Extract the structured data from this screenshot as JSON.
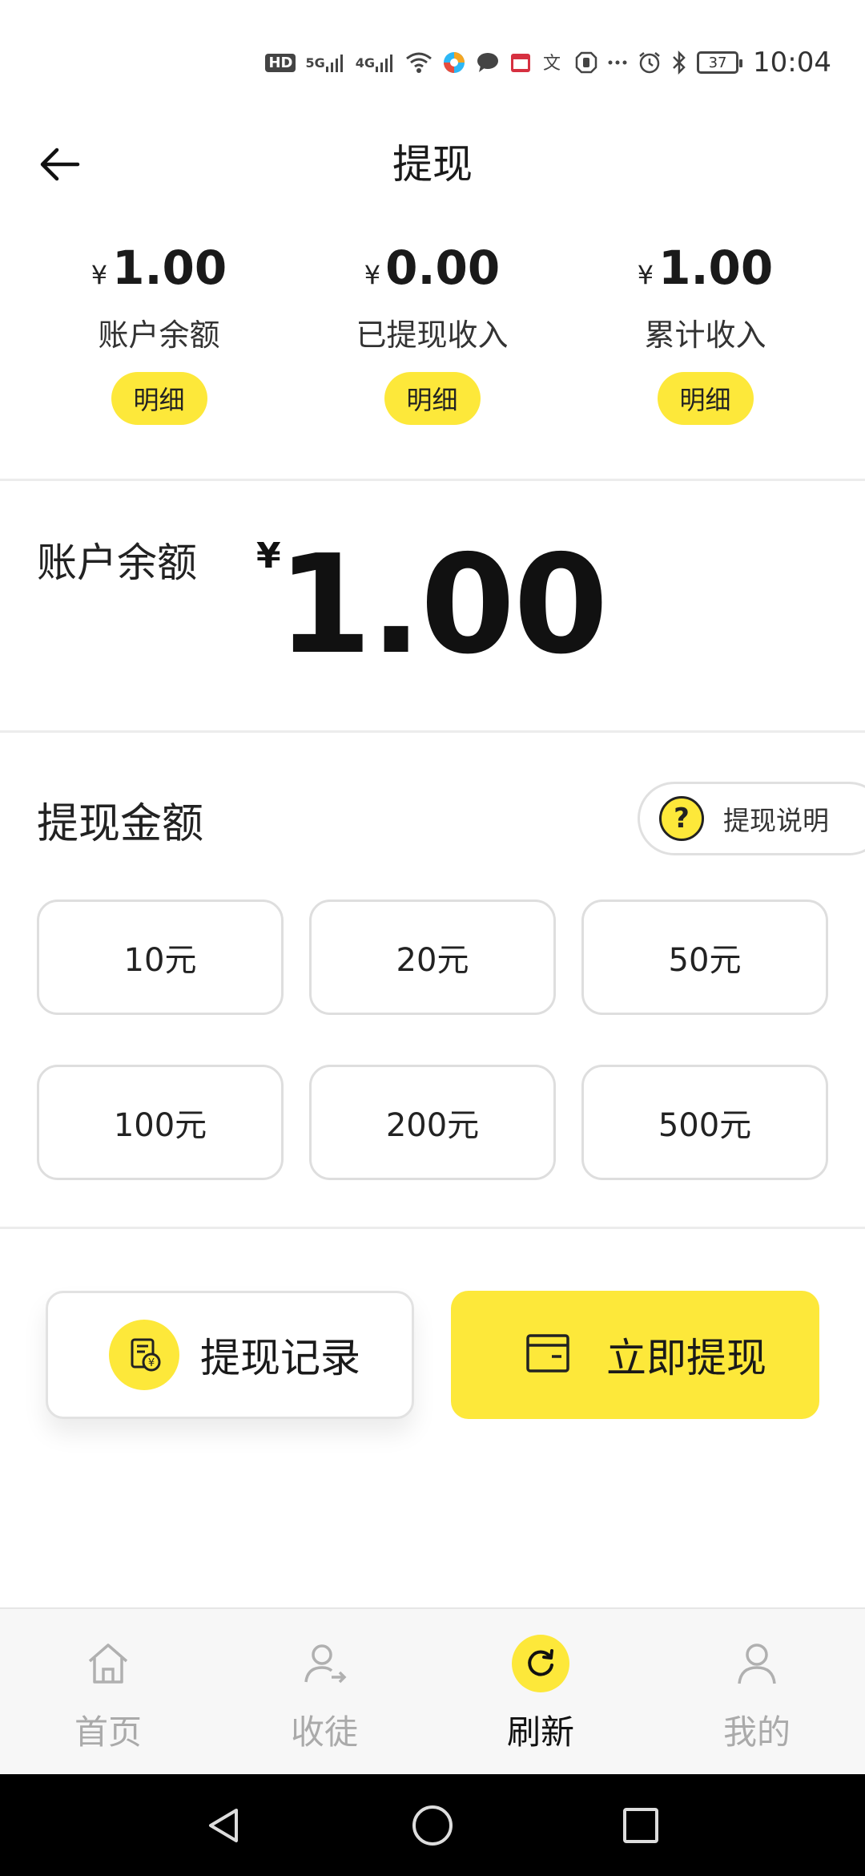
{
  "status_bar": {
    "hd": "HD",
    "sig1": "5G",
    "sig2": "4G",
    "battery": "37",
    "time": "10:04",
    "icons": [
      "hd-icon",
      "signal-5g-icon",
      "signal-4g-icon",
      "wifi-icon",
      "app-icon",
      "message-icon",
      "calendar-icon",
      "translate-icon",
      "hand-icon",
      "more-icon",
      "alarm-icon",
      "bluetooth-icon",
      "battery-icon"
    ]
  },
  "header": {
    "title": "提现",
    "back_icon": "arrow-left-icon"
  },
  "stats": [
    {
      "currency": "¥",
      "value": "1.00",
      "label": "账户余额",
      "button": "明细"
    },
    {
      "currency": "¥",
      "value": "0.00",
      "label": "已提现收入",
      "button": "明细"
    },
    {
      "currency": "¥",
      "value": "1.00",
      "label": "累计收入",
      "button": "明细"
    }
  ],
  "balance": {
    "label": "账户余额",
    "currency": "¥",
    "value": "1.00"
  },
  "withdraw": {
    "title": "提现金额",
    "explain_label": "提现说明",
    "explain_icon_text": "?",
    "options": [
      "10元",
      "20元",
      "50元",
      "100元",
      "200元",
      "500元"
    ]
  },
  "actions": {
    "record_label": "提现记录",
    "withdraw_label": "立即提现"
  },
  "tabbar": [
    {
      "label": "首页",
      "icon": "home-icon",
      "active": false
    },
    {
      "label": "收徒",
      "icon": "user-add-icon",
      "active": false
    },
    {
      "label": "刷新",
      "icon": "refresh-icon",
      "active": true
    },
    {
      "label": "我的",
      "icon": "user-icon",
      "active": false
    }
  ],
  "colors": {
    "accent": "#fde83a",
    "text": "#1a1a1a",
    "muted": "#aaaaaa",
    "border": "#dedede"
  }
}
